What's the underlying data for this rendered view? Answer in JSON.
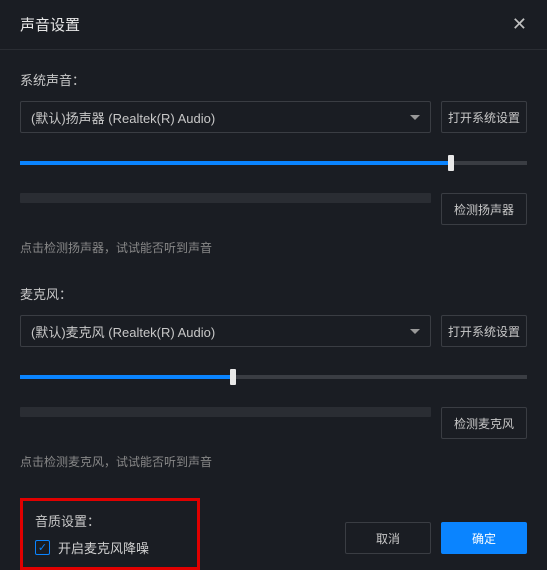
{
  "header": {
    "title": "声音设置"
  },
  "system": {
    "label": "系统声音：",
    "device": "(默认)扬声器 (Realtek(R) Audio)",
    "openSettings": "打开系统设置",
    "volumePercent": 85,
    "test": "检测扬声器",
    "hint": "点击检测扬声器，试试能否听到声音"
  },
  "mic": {
    "label": "麦克风：",
    "device": "(默认)麦克风 (Realtek(R) Audio)",
    "openSettings": "打开系统设置",
    "volumePercent": 42,
    "test": "检测麦克风",
    "hint": "点击检测麦克风，试试能否听到声音"
  },
  "quality": {
    "label": "音质设置：",
    "noiseReduction": "开启麦克风降噪"
  },
  "footer": {
    "cancel": "取消",
    "confirm": "确定"
  }
}
